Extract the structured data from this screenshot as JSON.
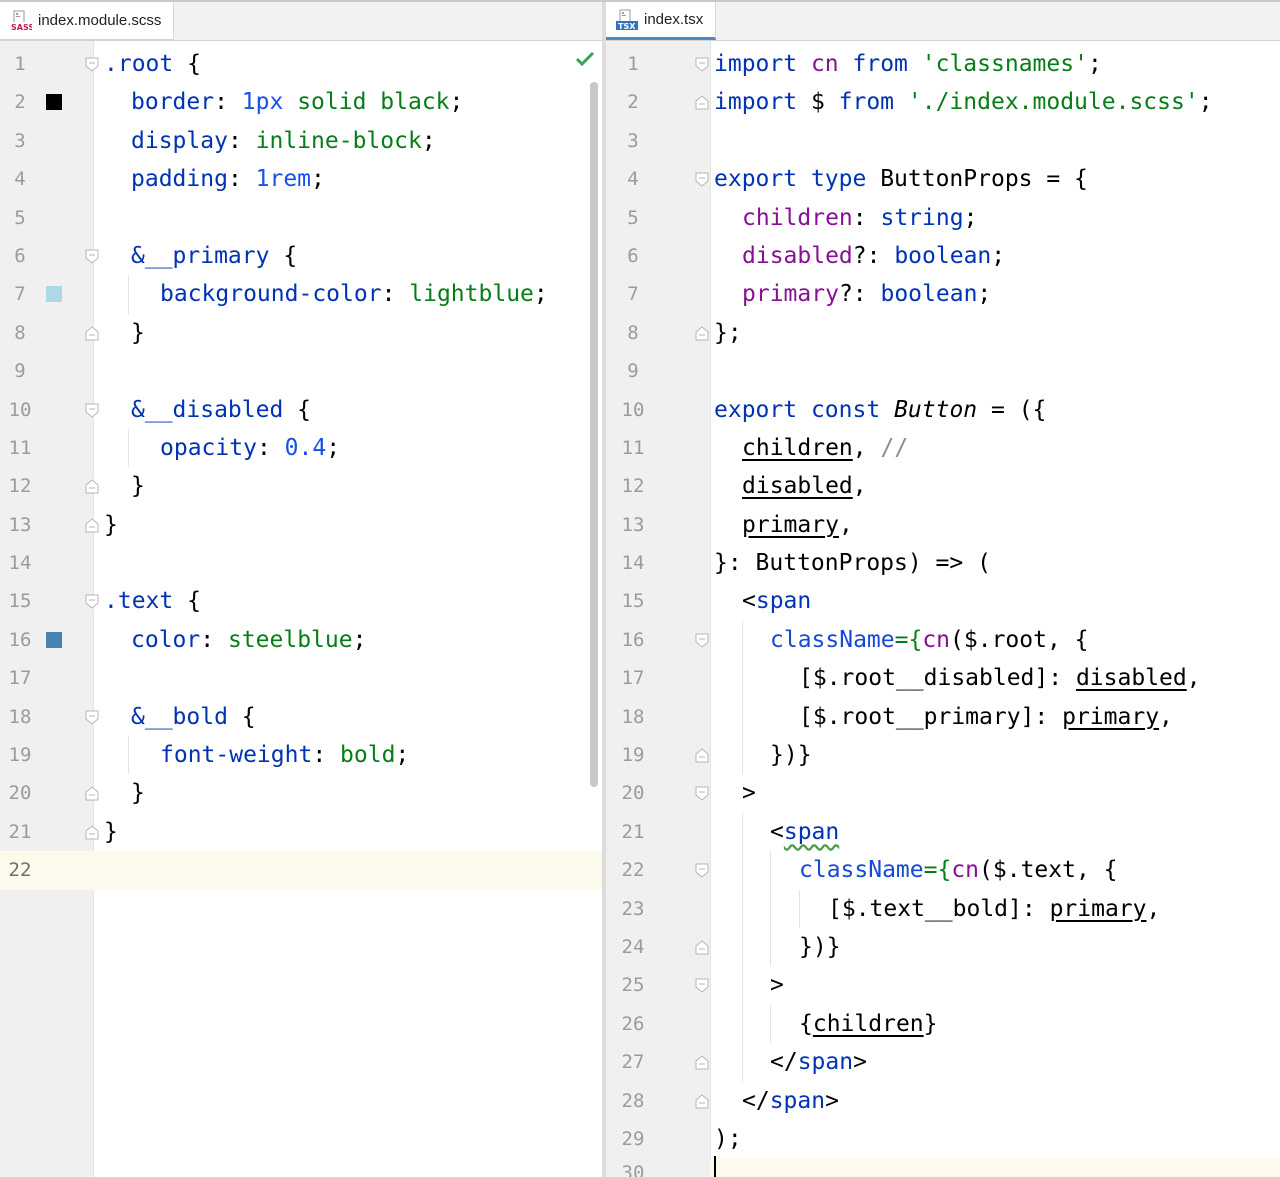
{
  "left_editor": {
    "tab": {
      "label": "index.module.scss",
      "icon": "sass-file-icon",
      "icon_text": "SASS"
    },
    "line_numbers": [
      "1",
      "2",
      "3",
      "4",
      "5",
      "6",
      "7",
      "8",
      "9",
      "10",
      "11",
      "12",
      "13",
      "14",
      "15",
      "16",
      "17",
      "18",
      "19",
      "20",
      "21",
      "22"
    ],
    "swatches": {
      "line2": "#000000",
      "line7": "#add8e6",
      "line16": "#4682b4"
    },
    "code": {
      "l1": {
        "sel": ".root",
        "brace": " {"
      },
      "l2": {
        "prop": "border",
        "sep": ": ",
        "num": "1px",
        "val": " solid black",
        "end": ";"
      },
      "l3": {
        "prop": "display",
        "sep": ": ",
        "val": "inline-block",
        "end": ";"
      },
      "l4": {
        "prop": "padding",
        "sep": ": ",
        "num": "1rem",
        "end": ";"
      },
      "l6": {
        "sel": "&__primary",
        "brace": " {"
      },
      "l7": {
        "prop": "background-color",
        "sep": ": ",
        "val": "lightblue",
        "end": ";"
      },
      "l8": {
        "text": "}"
      },
      "l10": {
        "sel": "&__disabled",
        "brace": " {"
      },
      "l11": {
        "prop": "opacity",
        "sep": ": ",
        "num": "0.4",
        "end": ";"
      },
      "l12": {
        "text": "}"
      },
      "l13": {
        "text": "}"
      },
      "l15": {
        "sel": ".text",
        "brace": " {"
      },
      "l16": {
        "prop": "color",
        "sep": ": ",
        "val": "steelblue",
        "end": ";"
      },
      "l18": {
        "sel": "&__bold",
        "brace": " {"
      },
      "l19": {
        "prop": "font-weight",
        "sep": ": ",
        "val": "bold",
        "end": ";"
      },
      "l20": {
        "text": "}"
      },
      "l21": {
        "text": "}"
      }
    }
  },
  "right_editor": {
    "tab": {
      "label": "index.tsx",
      "icon": "tsx-file-icon",
      "icon_text": "TSX"
    },
    "line_numbers": [
      "1",
      "2",
      "3",
      "4",
      "5",
      "6",
      "7",
      "8",
      "9",
      "10",
      "11",
      "12",
      "13",
      "14",
      "15",
      "16",
      "17",
      "18",
      "19",
      "20",
      "21",
      "22",
      "23",
      "24",
      "25",
      "26",
      "27",
      "28",
      "29",
      "30"
    ],
    "code": {
      "l1": {
        "kw": "import",
        "a": " ",
        "id": "cn",
        "b": " ",
        "kw2": "from",
        "c": " ",
        "str": "'classnames'",
        "end": ";"
      },
      "l2": {
        "kw": "import",
        "a": " $ ",
        "kw2": "from",
        "c": " ",
        "str": "'./index.module.scss'",
        "end": ";"
      },
      "l4": {
        "kw": "export",
        "a": " ",
        "kw2": "type",
        "b": " ButtonProps = {"
      },
      "l5": {
        "field": "children",
        "sep": ": ",
        "type": "string",
        "end": ";"
      },
      "l6": {
        "field": "disabled",
        "sep": "?: ",
        "type": "boolean",
        "end": ";"
      },
      "l7": {
        "field": "primary",
        "sep": "?: ",
        "type": "boolean",
        "end": ";"
      },
      "l8": {
        "text": "};"
      },
      "l10": {
        "kw": "export",
        "a": " ",
        "kw2": "const",
        "b": " ",
        "name": "Button",
        "c": " = ({"
      },
      "l11": {
        "param": "children",
        "sep": ", ",
        "cmt": "//"
      },
      "l12": {
        "param": "disabled",
        "sep": ","
      },
      "l13": {
        "param": "primary",
        "sep": ","
      },
      "l14": {
        "text": "}: ButtonProps) => ("
      },
      "l15": {
        "lt": "<",
        "tag": "span"
      },
      "l16": {
        "attr": "className",
        "eq": "={",
        "fn": "cn",
        "rest": "($.root, {"
      },
      "l17": {
        "pre": "[$.root__disabled]: ",
        "param": "disabled",
        "end": ","
      },
      "l18": {
        "pre": "[$.root__primary]: ",
        "param": "primary",
        "end": ","
      },
      "l19": {
        "text": "})}"
      },
      "l20": {
        "text": ">"
      },
      "l21": {
        "lt": "<",
        "tag": "span"
      },
      "l22": {
        "attr": "className",
        "eq": "={",
        "fn": "cn",
        "rest": "($.text, {"
      },
      "l23": {
        "pre": "[$.text__bold]: ",
        "param": "primary",
        "end": ","
      },
      "l24": {
        "text": "})}"
      },
      "l25": {
        "text": ">"
      },
      "l26": {
        "open": "{",
        "param": "children",
        "close": "}"
      },
      "l27": {
        "lt": "</",
        "tag": "span",
        "gt": ">"
      },
      "l28": {
        "lt": "</",
        "tag": "span",
        "gt": ">"
      },
      "l29": {
        "text": ");"
      }
    }
  }
}
